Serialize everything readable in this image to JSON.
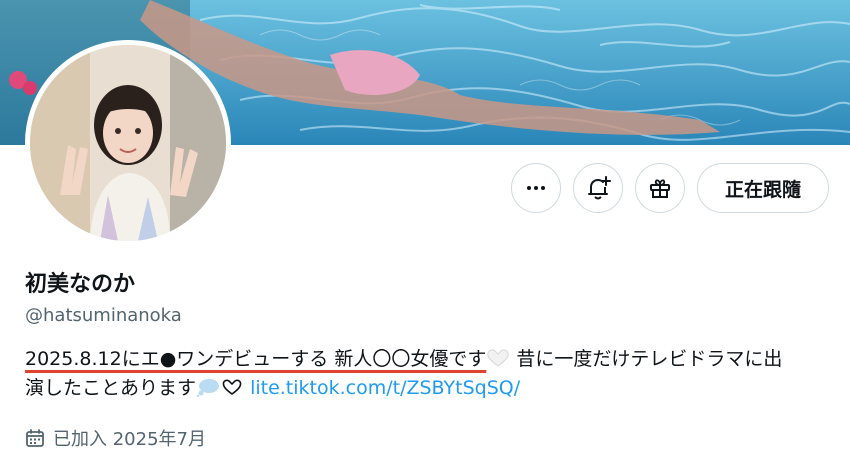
{
  "profile": {
    "display_name": "初美なのか",
    "handle": "@hatsuminanoka",
    "bio_part1": "2025.8.12にエ●ワンデビューする 新人〇〇女優です",
    "bio_part2": " 昔に一度だけテレビドラマに出",
    "bio_part3": "演したことあります",
    "bio_link": "lite.tiktok.com/t/ZSBYtSqSQ/",
    "joined": "已加入 2025年7月"
  },
  "actions": {
    "more_icon": "more-icon",
    "notify_icon": "bell-plus-icon",
    "gift_icon": "gift-icon",
    "following_label": "正在跟隨"
  },
  "colors": {
    "link": "#1d9bf0",
    "secondary_text": "#536471",
    "underline_accent": "#e0442f",
    "border": "#cfd9de"
  }
}
